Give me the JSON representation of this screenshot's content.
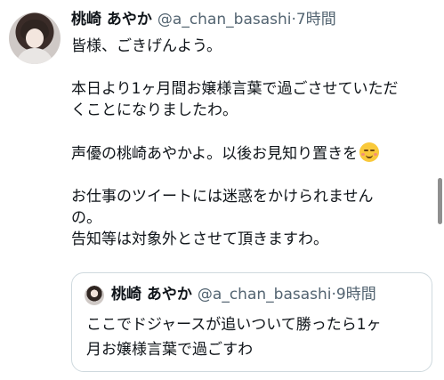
{
  "tweet": {
    "author": {
      "display_name": "桃崎 あやか",
      "handle": "@a_chan_basashi",
      "time": "·7時間"
    },
    "text_lines": [
      "皆様、ごきげんよう。",
      "",
      "本日より1ヶ月間お嬢様言葉で過ごさせていただ",
      "くことになりましたわ。",
      "",
      "声優の桃崎あやかよ。以後お見知り置きを",
      "",
      "お仕事のツイートには迷惑をかけられません",
      "の。",
      "告知等は対象外とさせて頂きますわ。"
    ],
    "emoji": "smiling-face-with-blush"
  },
  "quote": {
    "author": {
      "display_name": "桃崎 あやか",
      "handle": "@a_chan_basashi",
      "time": "·9時間"
    },
    "text_lines": [
      "ここでドジャースが追いついて勝ったら1ヶ",
      "月お嬢様言葉で過ごすわ"
    ]
  },
  "colors": {
    "text_primary": "#0f1419",
    "text_secondary": "#536471",
    "quote_border": "#cfd9de"
  }
}
